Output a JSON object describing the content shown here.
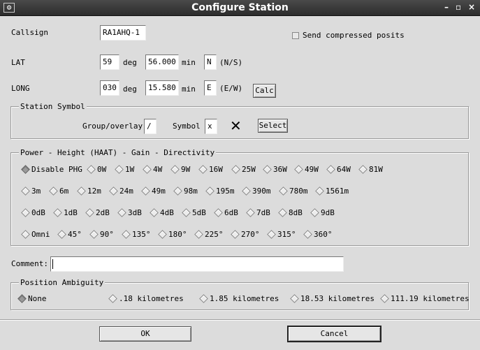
{
  "window": {
    "title": "Configure Station",
    "controls": [
      "–",
      "▫",
      "×"
    ]
  },
  "callsign": {
    "label": "Callsign",
    "value": "RA1AHQ-1"
  },
  "compressed": {
    "label": "Send compressed posits"
  },
  "lat": {
    "label": "LAT",
    "deg": "59",
    "deg_unit": "deg",
    "min": "56.000",
    "min_unit": "min",
    "hemi": "N",
    "hemi_hint": "(N/S)"
  },
  "long": {
    "label": "LONG",
    "deg": "030",
    "deg_unit": "deg",
    "min": "15.580",
    "min_unit": "min",
    "hemi": "E",
    "hemi_hint": "(E/W)",
    "calc": "Calc"
  },
  "symbol": {
    "group_title": "Station Symbol",
    "overlay_label": "Group/overlay",
    "overlay_value": "/",
    "symbol_label": "Symbol",
    "symbol_value": "x",
    "preview_glyph": "✕",
    "select": "Select"
  },
  "phg": {
    "group_title": "Power - Height (HAAT) - Gain - Directivity",
    "power": [
      "Disable PHG",
      "0W",
      "1W",
      "4W",
      "9W",
      "16W",
      "25W",
      "36W",
      "49W",
      "64W",
      "81W"
    ],
    "height": [
      "3m",
      "6m",
      "12m",
      "24m",
      "49m",
      "98m",
      "195m",
      "390m",
      "780m",
      "1561m"
    ],
    "gain": [
      "0dB",
      "1dB",
      "2dB",
      "3dB",
      "4dB",
      "5dB",
      "6dB",
      "7dB",
      "8dB",
      "9dB"
    ],
    "direction": [
      "Omni",
      "45°",
      "90°",
      "135°",
      "180°",
      "225°",
      "270°",
      "315°",
      "360°"
    ],
    "selected_power": "Disable PHG"
  },
  "comment": {
    "label": "Comment:",
    "value": ""
  },
  "ambiguity": {
    "group_title": "Position Ambiguity",
    "options": [
      "None",
      ".18 kilometres",
      "1.85 kilometres",
      "18.53 kilometres",
      "111.19 kilometres"
    ],
    "selected": "None"
  },
  "buttons": {
    "ok": "OK",
    "cancel": "Cancel"
  }
}
